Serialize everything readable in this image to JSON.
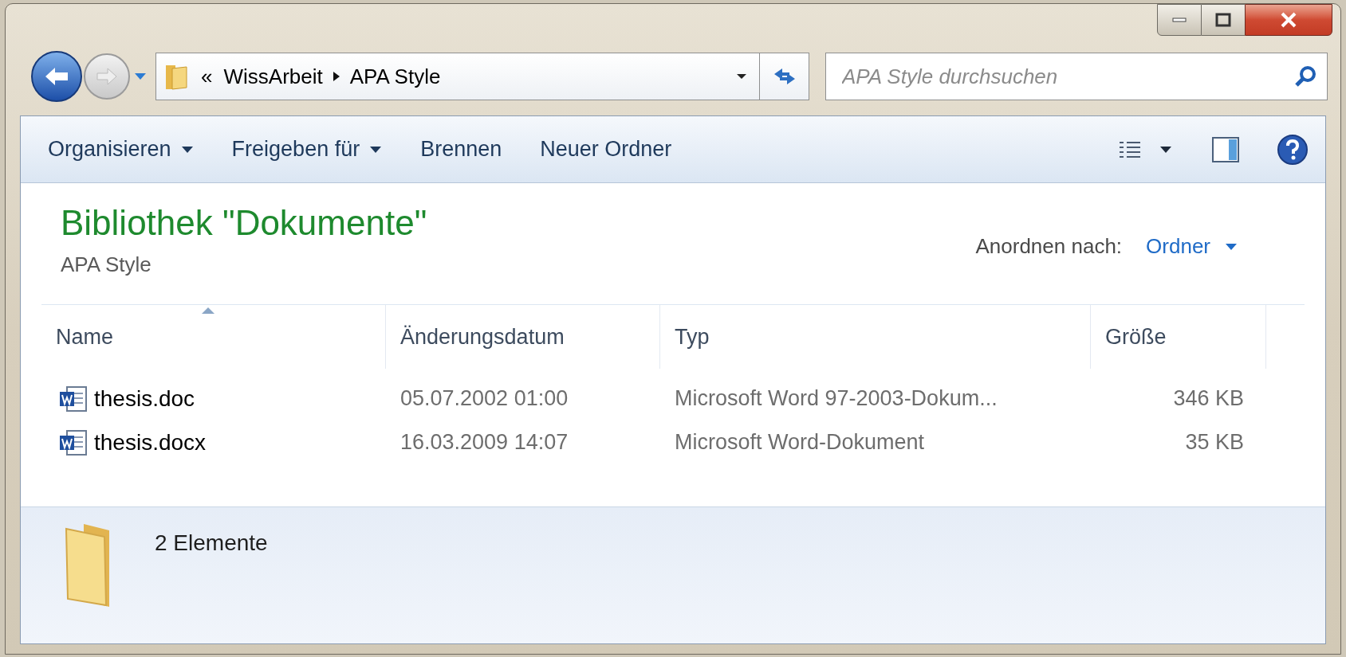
{
  "address_bar": {
    "overflow": "«",
    "segments": [
      "WissArbeit",
      "APA Style"
    ]
  },
  "search": {
    "placeholder": "APA Style durchsuchen"
  },
  "toolbar": {
    "items": [
      {
        "label": "Organisieren",
        "dropdown": true
      },
      {
        "label": "Freigeben für",
        "dropdown": true
      },
      {
        "label": "Brennen",
        "dropdown": false
      },
      {
        "label": "Neuer Ordner",
        "dropdown": false
      }
    ]
  },
  "library": {
    "title": "Bibliothek \"Dokumente\"",
    "subtitle": "APA Style",
    "arrange_label": "Anordnen nach:",
    "arrange_value": "Ordner"
  },
  "table": {
    "columns": [
      {
        "label": "Name",
        "sorted": true
      },
      {
        "label": "Änderungsdatum",
        "sorted": false
      },
      {
        "label": "Typ",
        "sorted": false
      },
      {
        "label": "Größe",
        "sorted": false
      }
    ],
    "rows": [
      {
        "name": "thesis.doc",
        "date": "05.07.2002 01:00",
        "type": "Microsoft Word 97-2003-Dokum...",
        "size": "346 KB"
      },
      {
        "name": "thesis.docx",
        "date": "16.03.2009 14:07",
        "type": "Microsoft Word-Dokument",
        "size": "35 KB"
      }
    ]
  },
  "status_bar": {
    "count": "2 Elemente"
  }
}
